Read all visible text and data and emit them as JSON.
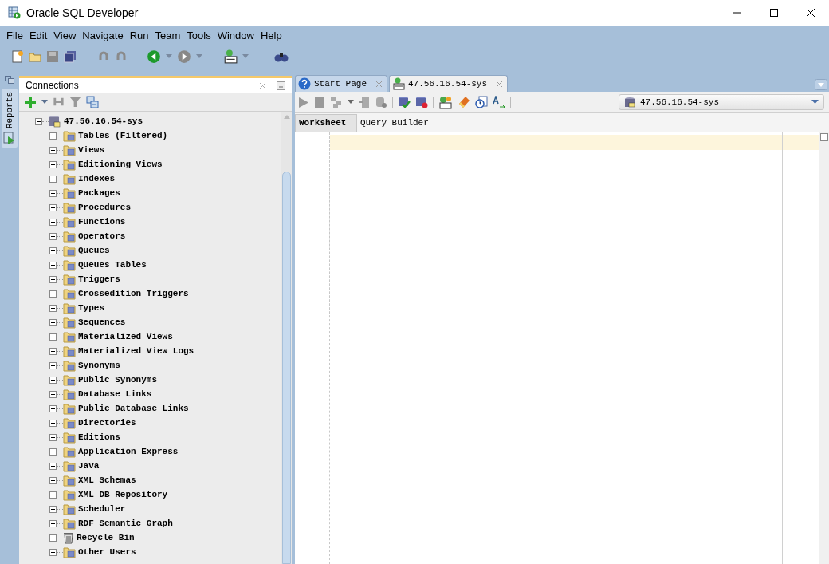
{
  "window": {
    "title": "Oracle SQL Developer"
  },
  "menu": [
    "File",
    "Edit",
    "View",
    "Navigate",
    "Run",
    "Team",
    "Tools",
    "Window",
    "Help"
  ],
  "side_tabs": [
    {
      "label": "Reports",
      "selected": false
    }
  ],
  "connections_panel": {
    "title": "Connections",
    "tree": [
      {
        "label": "47.56.16.54-sys",
        "kind": "database",
        "expanded": true,
        "children": [
          {
            "label": "Tables (Filtered)",
            "kind": "folder",
            "expanded": false
          },
          {
            "label": "Views",
            "kind": "folder",
            "expanded": false
          },
          {
            "label": "Editioning Views",
            "kind": "folder",
            "expanded": false
          },
          {
            "label": "Indexes",
            "kind": "folder",
            "expanded": false
          },
          {
            "label": "Packages",
            "kind": "folder",
            "expanded": false
          },
          {
            "label": "Procedures",
            "kind": "folder",
            "expanded": false
          },
          {
            "label": "Functions",
            "kind": "folder",
            "expanded": false
          },
          {
            "label": "Operators",
            "kind": "folder",
            "expanded": false
          },
          {
            "label": "Queues",
            "kind": "folder",
            "expanded": false
          },
          {
            "label": "Queues Tables",
            "kind": "folder",
            "expanded": false
          },
          {
            "label": "Triggers",
            "kind": "folder",
            "expanded": false
          },
          {
            "label": "Crossedition Triggers",
            "kind": "folder",
            "expanded": false
          },
          {
            "label": "Types",
            "kind": "folder",
            "expanded": false
          },
          {
            "label": "Sequences",
            "kind": "folder",
            "expanded": false
          },
          {
            "label": "Materialized Views",
            "kind": "folder",
            "expanded": false
          },
          {
            "label": "Materialized View Logs",
            "kind": "folder",
            "expanded": false
          },
          {
            "label": "Synonyms",
            "kind": "folder",
            "expanded": false
          },
          {
            "label": "Public Synonyms",
            "kind": "folder",
            "expanded": false
          },
          {
            "label": "Database Links",
            "kind": "folder",
            "expanded": false
          },
          {
            "label": "Public Database Links",
            "kind": "folder",
            "expanded": false
          },
          {
            "label": "Directories",
            "kind": "folder",
            "expanded": false
          },
          {
            "label": "Editions",
            "kind": "folder",
            "expanded": false
          },
          {
            "label": "Application Express",
            "kind": "folder",
            "expanded": false
          },
          {
            "label": "Java",
            "kind": "folder",
            "expanded": false
          },
          {
            "label": "XML Schemas",
            "kind": "folder",
            "expanded": false
          },
          {
            "label": "XML DB Repository",
            "kind": "folder",
            "expanded": false
          },
          {
            "label": "Scheduler",
            "kind": "folder",
            "expanded": false
          },
          {
            "label": "RDF Semantic Graph",
            "kind": "folder",
            "expanded": false
          },
          {
            "label": "Recycle Bin",
            "kind": "trash",
            "expanded": false
          },
          {
            "label": "Other Users",
            "kind": "folder",
            "expanded": false
          }
        ]
      }
    ]
  },
  "editor_tabs": [
    {
      "label": "Start Page",
      "kind": "help",
      "selected": false
    },
    {
      "label": "47.56.16.54-sys",
      "kind": "sql",
      "selected": true
    }
  ],
  "connection_select": {
    "value": "47.56.16.54-sys"
  },
  "worksheet_tabs": [
    {
      "label": "Worksheet",
      "selected": true
    },
    {
      "label": "Query Builder",
      "selected": false
    }
  ]
}
